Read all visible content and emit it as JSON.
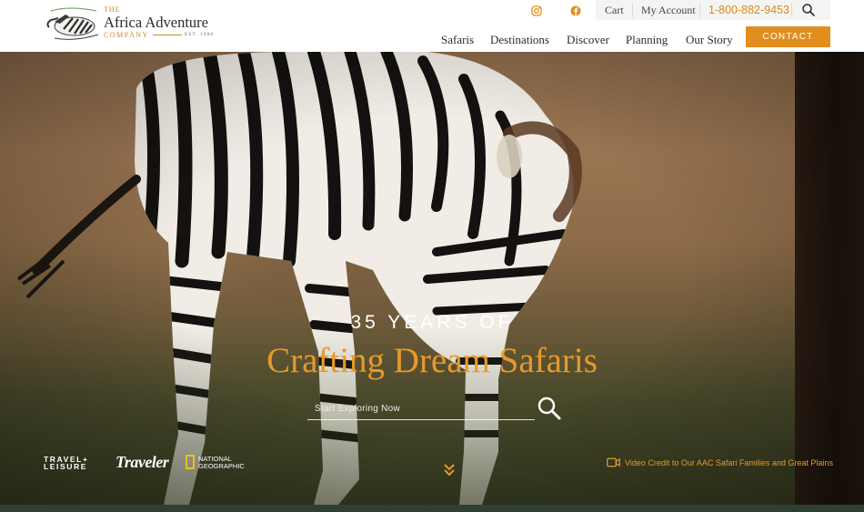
{
  "brand": {
    "the": "THE",
    "name": "Africa Adventure",
    "company": "COMPANY",
    "est": "EST. 1986"
  },
  "topbar": {
    "cart": "Cart",
    "account": "My Account",
    "phone": "1-800-882-9453"
  },
  "nav": {
    "items": [
      "Safaris",
      "Destinations",
      "Discover",
      "Planning",
      "Our Story"
    ],
    "contact": "CONTACT"
  },
  "hero": {
    "kicker": "35 YEARS OF",
    "title": "Crafting Dream Safaris",
    "search_placeholder": "Start Exploring Now",
    "video_credit": "Video Credit to Our AAC Safari Families and Great Plains"
  },
  "press": {
    "travel_leisure_1": "TRAVEL+",
    "travel_leisure_2": "LEISURE",
    "traveler": "Traveler",
    "natgeo_1": "NATIONAL",
    "natgeo_2": "GEOGRAPHIC"
  },
  "icons": {
    "instagram": "instagram-icon",
    "facebook": "facebook-icon",
    "search": "search-icon",
    "chevron": "double-chevron-down-icon",
    "video": "video-camera-icon"
  },
  "colors": {
    "accent": "#e08f1f",
    "footer_green": "#2d4033"
  }
}
